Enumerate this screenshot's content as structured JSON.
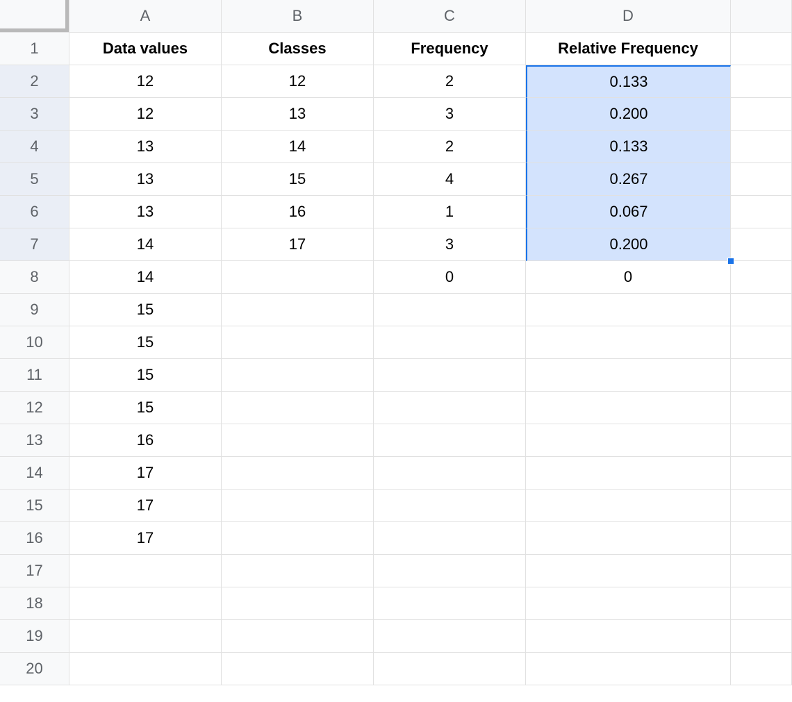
{
  "columns": {
    "A": "A",
    "B": "B",
    "C": "C",
    "D": "D"
  },
  "rowNumbers": [
    "1",
    "2",
    "3",
    "4",
    "5",
    "6",
    "7",
    "8",
    "9",
    "10",
    "11",
    "12",
    "13",
    "14",
    "15",
    "16",
    "17",
    "18",
    "19",
    "20"
  ],
  "headers": {
    "A": "Data values",
    "B": "Classes",
    "C": "Frequency",
    "D": "Relative Frequency"
  },
  "colA": [
    "12",
    "12",
    "13",
    "13",
    "13",
    "14",
    "14",
    "15",
    "15",
    "15",
    "15",
    "16",
    "17",
    "17",
    "17"
  ],
  "colB": [
    "12",
    "13",
    "14",
    "15",
    "16",
    "17"
  ],
  "colC": [
    "2",
    "3",
    "2",
    "4",
    "1",
    "3",
    "0"
  ],
  "colD": [
    "0.133",
    "0.200",
    "0.133",
    "0.267",
    "0.067",
    "0.200",
    "0"
  ],
  "selection": {
    "column": "D",
    "startRow": 2,
    "endRow": 7
  }
}
